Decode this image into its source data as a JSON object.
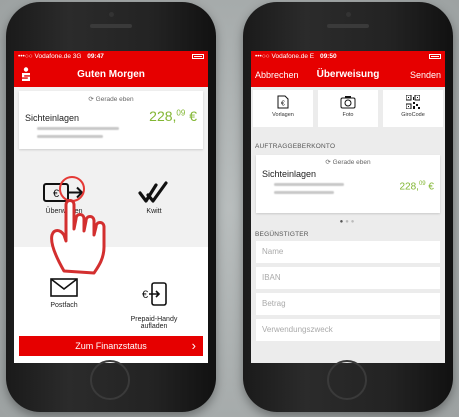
{
  "left_phone": {
    "status": {
      "carrier": "•••○○ Vodafone.de  3G",
      "time": "09:47"
    },
    "header": {
      "title": "Guten Morgen",
      "logo_icon": "sparkasse-logo-icon"
    },
    "account": {
      "refresh": "Gerade eben",
      "name": "Sichteinlagen",
      "amount_main": "228,",
      "amount_cents": "09",
      "currency": " €"
    },
    "actions": [
      {
        "label": "Überweisen",
        "icon": "transfer-icon"
      },
      {
        "label": "Kwitt",
        "icon": "kwitt-icon"
      },
      {
        "label": "Postfach",
        "icon": "mail-icon"
      },
      {
        "label": "Prepaid-Handy\naufladen",
        "icon": "prepaid-phone-icon"
      }
    ],
    "bottom_button": "Zum Finanzstatus"
  },
  "right_phone": {
    "status": {
      "carrier": "•••○○ Vodafone.de  E",
      "time": "09:50"
    },
    "header": {
      "cancel": "Abbrechen",
      "title": "Überweisung",
      "send": "Senden"
    },
    "tools": [
      {
        "label": "Vorlagen",
        "icon": "template-icon"
      },
      {
        "label": "Foto",
        "icon": "camera-icon"
      },
      {
        "label": "GiroCode",
        "icon": "qr-code-icon"
      }
    ],
    "section_account": "AUFTRAGGEBERKONTO",
    "account": {
      "refresh": "Gerade eben",
      "name": "Sichteinlagen",
      "amount_main": "228,",
      "amount_cents": "09",
      "currency": " €"
    },
    "section_recipient": "BEGÜNSTIGTER",
    "fields": [
      {
        "placeholder": "Name"
      },
      {
        "placeholder": "IBAN"
      },
      {
        "placeholder": "Betrag"
      },
      {
        "placeholder": "Verwendungszweck"
      }
    ]
  },
  "colors": {
    "brand_red": "#e60000",
    "amount_green": "#82b633"
  }
}
